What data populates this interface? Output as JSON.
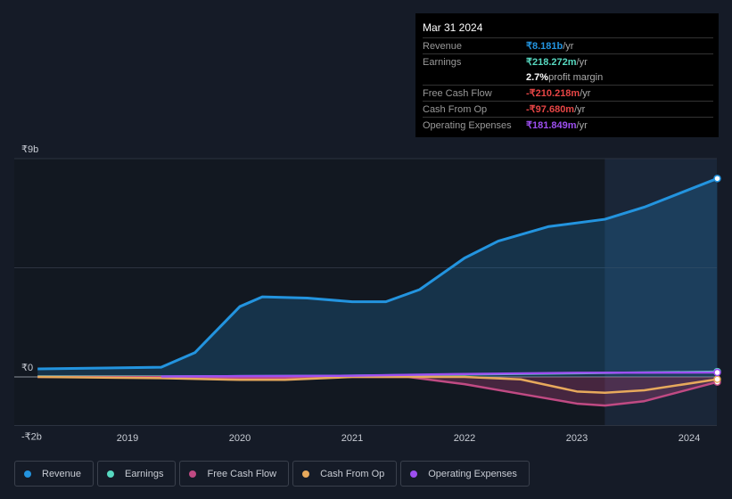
{
  "chart_data": {
    "type": "area",
    "x_range": [
      2018.15,
      2024.25
    ],
    "ylim": [
      -2,
      9
    ],
    "y_ticks": [
      {
        "v": 9,
        "label": "₹9b"
      },
      {
        "v": 0,
        "label": "₹0"
      },
      {
        "v": -2,
        "label": "-₹2b"
      }
    ],
    "x_ticks": [
      "2019",
      "2020",
      "2021",
      "2022",
      "2023",
      "2024"
    ],
    "forecast_start": 2023.25,
    "series": [
      {
        "name": "Revenue",
        "color": "#2394df",
        "fill": true,
        "points": [
          [
            2018.2,
            0.33
          ],
          [
            2019.3,
            0.4
          ],
          [
            2019.6,
            1.0
          ],
          [
            2020.0,
            2.9
          ],
          [
            2020.2,
            3.3
          ],
          [
            2020.6,
            3.25
          ],
          [
            2021.0,
            3.1
          ],
          [
            2021.3,
            3.1
          ],
          [
            2021.6,
            3.6
          ],
          [
            2022.0,
            4.9
          ],
          [
            2022.3,
            5.6
          ],
          [
            2022.75,
            6.2
          ],
          [
            2023.25,
            6.5
          ],
          [
            2023.6,
            7.0
          ],
          [
            2024.25,
            8.181
          ]
        ]
      },
      {
        "name": "Earnings",
        "color": "#57d9c1",
        "fill": false,
        "points": [
          [
            2018.2,
            0.02
          ],
          [
            2019.3,
            0.02
          ],
          [
            2020.0,
            0.03
          ],
          [
            2021.0,
            0.05
          ],
          [
            2022.0,
            0.1
          ],
          [
            2023.0,
            0.15
          ],
          [
            2024.25,
            0.218
          ]
        ]
      },
      {
        "name": "Free Cash Flow",
        "color": "#c04a83",
        "fill": true,
        "points": [
          [
            2018.2,
            0
          ],
          [
            2019.3,
            0
          ],
          [
            2020.0,
            -0.05
          ],
          [
            2021.0,
            0
          ],
          [
            2021.5,
            0
          ],
          [
            2022.0,
            -0.3
          ],
          [
            2022.5,
            -0.7
          ],
          [
            2023.0,
            -1.1
          ],
          [
            2023.25,
            -1.18
          ],
          [
            2023.6,
            -1.0
          ],
          [
            2024.25,
            -0.21
          ]
        ]
      },
      {
        "name": "Cash From Op",
        "color": "#e7a95c",
        "fill": false,
        "points": [
          [
            2018.2,
            0
          ],
          [
            2019.3,
            -0.05
          ],
          [
            2020.0,
            -0.12
          ],
          [
            2020.4,
            -0.12
          ],
          [
            2021.0,
            0
          ],
          [
            2022.0,
            0
          ],
          [
            2022.5,
            -0.1
          ],
          [
            2023.0,
            -0.6
          ],
          [
            2023.25,
            -0.65
          ],
          [
            2023.6,
            -0.55
          ],
          [
            2024.25,
            -0.098
          ]
        ]
      },
      {
        "name": "Operating Expenses",
        "color": "#9d4ff0",
        "fill": false,
        "points": [
          [
            2019.3,
            0.02
          ],
          [
            2020.0,
            0.03
          ],
          [
            2021.0,
            0.05
          ],
          [
            2022.0,
            0.12
          ],
          [
            2023.0,
            0.17
          ],
          [
            2024.25,
            0.182
          ]
        ]
      }
    ]
  },
  "tooltip": {
    "date": "Mar 31 2024",
    "rows": [
      {
        "label": "Revenue",
        "value": "₹8.181b",
        "unit": " /yr",
        "color": "#2394df"
      },
      {
        "label": "Earnings",
        "value": "₹218.272m",
        "unit": " /yr",
        "color": "#57d9c1"
      },
      {
        "label": "",
        "value": "2.7%",
        "unit": " profit margin",
        "color": "#ffffff"
      },
      {
        "label": "Free Cash Flow",
        "value": "-₹210.218m",
        "unit": " /yr",
        "color": "#e64545"
      },
      {
        "label": "Cash From Op",
        "value": "-₹97.680m",
        "unit": " /yr",
        "color": "#e64545"
      },
      {
        "label": "Operating Expenses",
        "value": "₹181.849m",
        "unit": " /yr",
        "color": "#9d4ff0"
      }
    ]
  }
}
